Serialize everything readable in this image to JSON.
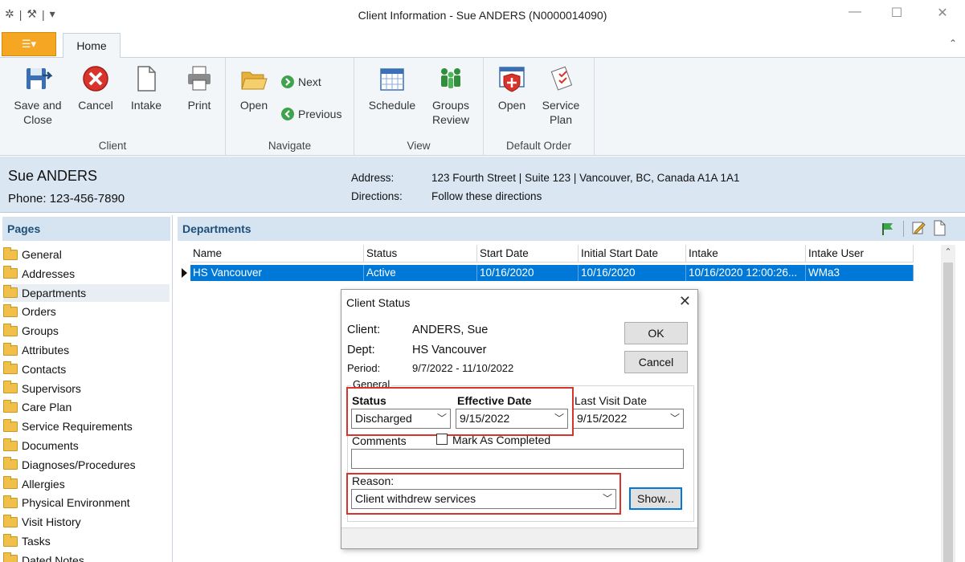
{
  "window": {
    "title": "Client Information - Sue ANDERS  (N0000014090)"
  },
  "ribbon": {
    "home_tab": "Home",
    "groups": {
      "client": {
        "label": "Client",
        "save_close": "Save and\nClose",
        "cancel": "Cancel",
        "intake": "Intake",
        "print": "Print"
      },
      "navigate": {
        "label": "Navigate",
        "open": "Open",
        "next": "Next",
        "previous": "Previous"
      },
      "view": {
        "label": "View",
        "schedule": "Schedule",
        "groups_review": "Groups\nReview"
      },
      "default_order": {
        "label": "Default Order",
        "open": "Open",
        "service_plan": "Service\nPlan"
      }
    }
  },
  "client": {
    "name": "Sue ANDERS",
    "phone": "Phone:  123-456-7890",
    "address_label": "Address:",
    "address": "123 Fourth Street | Suite 123 |  Vancouver, BC, Canada A1A 1A1",
    "directions_label": "Directions:",
    "directions": "Follow these directions"
  },
  "pages": {
    "header": "Pages",
    "items": [
      "General",
      "Addresses",
      "Departments",
      "Orders",
      "Groups",
      "Attributes",
      "Contacts",
      "Supervisors",
      "Care Plan",
      "Service Requirements",
      "Documents",
      "Diagnoses/Procedures",
      "Allergies",
      "Physical Environment",
      "Visit History",
      "Tasks",
      "Dated Notes"
    ],
    "active": "Departments"
  },
  "departments": {
    "title": "Departments",
    "columns": [
      "Name",
      "Status",
      "Start Date",
      "Initial Start Date",
      "Intake",
      "Intake User"
    ],
    "rows": [
      [
        "HS Vancouver",
        "Active",
        "10/16/2020",
        "10/16/2020",
        "10/16/2020 12:00:26...",
        "WMa3"
      ]
    ]
  },
  "dialog": {
    "title": "Client Status",
    "client_label": "Client:",
    "client_value": "ANDERS, Sue",
    "dept_label": "Dept:",
    "dept_value": "HS Vancouver",
    "period_label": "Period:",
    "period_value": "9/7/2022 - 11/10/2022",
    "ok": "OK",
    "cancel": "Cancel",
    "general_label": "General",
    "status_label": "Status",
    "status_value": "Discharged",
    "effective_date_label": "Effective Date",
    "effective_date_value": "9/15/2022",
    "last_visit_label": "Last Visit Date",
    "last_visit_value": "9/15/2022",
    "comments_label": "Comments",
    "mark_completed_label": "Mark As Completed",
    "reason_label": "Reason:",
    "reason_value": "Client withdrew services",
    "show": "Show..."
  },
  "colors": {
    "selection": "#0078d7",
    "highlight": "#d9342b",
    "header_bg": "#dae6f2",
    "file_button": "#f5a623"
  }
}
